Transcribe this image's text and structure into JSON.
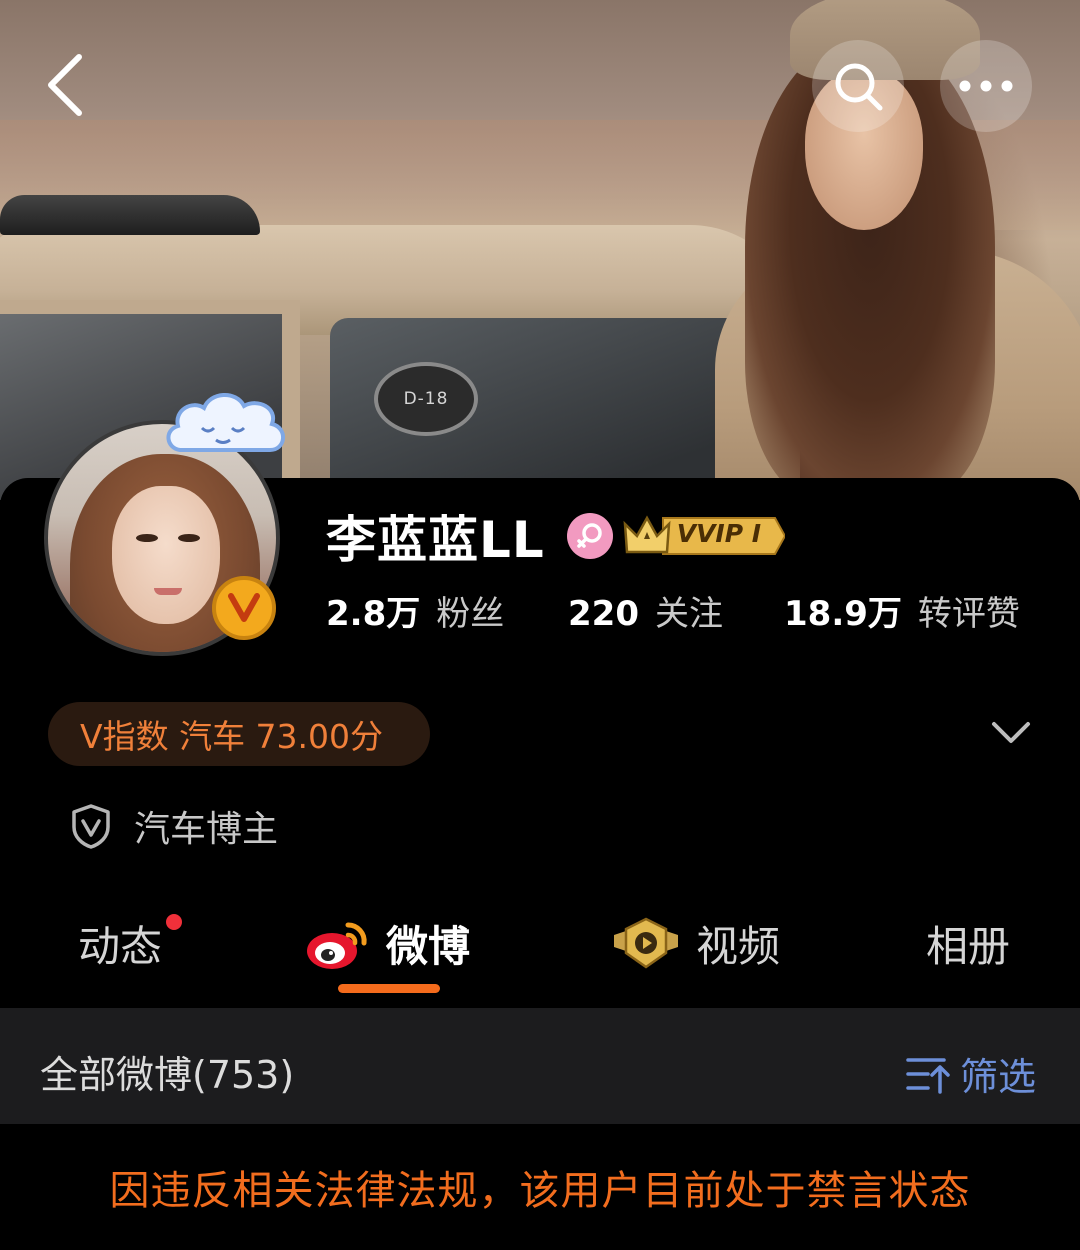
{
  "header": {
    "car_sticker_text": "D-18"
  },
  "profile": {
    "name": "李蓝蓝LL",
    "vip_label": "VVIP I",
    "stats": [
      {
        "value": "2.8万",
        "label": "粉丝"
      },
      {
        "value": "220",
        "label": "关注"
      },
      {
        "value": "18.9万",
        "label": "转评赞"
      }
    ],
    "v_index": "V指数 汽车 73.00分",
    "role": "汽车博主"
  },
  "tabs": [
    {
      "label": "动态",
      "has_dot": true
    },
    {
      "label": "微博",
      "active": true
    },
    {
      "label": "视频"
    },
    {
      "label": "相册"
    }
  ],
  "filter": {
    "summary": "全部微博(753)",
    "filter_label": "筛选"
  },
  "notice": "因违反相关法律法规，该用户目前处于禁言状态",
  "colors": {
    "accent_orange": "#f46b1c",
    "notice_text": "#f26d1e",
    "filter_blue": "#6d8fd9",
    "vip_gold": "#e8b84a",
    "female_pink": "#f29ac0"
  },
  "icons": [
    "back-arrow-icon",
    "search-icon",
    "more-icon",
    "cloud-icon",
    "verified-v-icon",
    "female-icon",
    "crown-icon",
    "chevron-down-icon",
    "shield-v-icon",
    "weibo-icon",
    "video-icon",
    "filter-sort-icon"
  ]
}
